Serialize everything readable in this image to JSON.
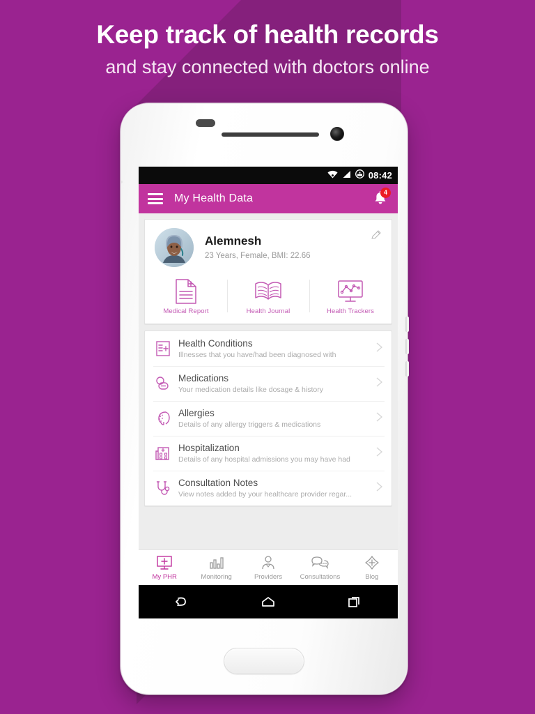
{
  "promo": {
    "headline_line1": "Keep track of health records",
    "headline_line2": "and stay connected with doctors online",
    "background_color": "#9A2390",
    "shadow_color": "#85207C"
  },
  "statusbar": {
    "time": "08:42",
    "icons": [
      "wifi-icon",
      "signal-icon",
      "battery-icon"
    ]
  },
  "appbar": {
    "menu_icon": "hamburger-menu-icon",
    "title": "My Health Data",
    "notification_icon": "bell-icon",
    "notification_count": "4",
    "color": "#C1349E"
  },
  "profile": {
    "avatar": "user-photo",
    "name": "Alemnesh",
    "details": "23 Years, Female, BMI: 22.66",
    "edit_icon": "pencil-edit-icon"
  },
  "quick_actions": [
    {
      "label": "Medical Report",
      "icon": "document-plus-icon"
    },
    {
      "label": "Health Journal",
      "icon": "open-book-icon"
    },
    {
      "label": "Health Trackers",
      "icon": "monitor-chart-icon"
    }
  ],
  "records": [
    {
      "title": "Health Conditions",
      "subtitle": "Illnesses that you have/had been diagnosed with",
      "icon": "clipboard-plus-icon"
    },
    {
      "title": "Medications",
      "subtitle": "Your medication details like dosage & history",
      "icon": "pills-icon"
    },
    {
      "title": "Allergies",
      "subtitle": "Details of any allergy triggers & medications",
      "icon": "face-allergy-icon"
    },
    {
      "title": "Hospitalization",
      "subtitle": "Details of any hospital admissions you may have had",
      "icon": "hospital-building-icon"
    },
    {
      "title": "Consultation Notes",
      "subtitle": "View notes added by your healthcare provider regar...",
      "icon": "stethoscope-icon"
    }
  ],
  "tabs": [
    {
      "label": "My PHR",
      "icon": "monitor-plus-icon",
      "active": true
    },
    {
      "label": "Monitoring",
      "icon": "bar-chart-icon",
      "active": false
    },
    {
      "label": "Providers",
      "icon": "doctor-person-icon",
      "active": false
    },
    {
      "label": "Consultations",
      "icon": "chat-bubbles-icon",
      "active": false
    },
    {
      "label": "Blog",
      "icon": "diamond-plus-icon",
      "active": false
    }
  ],
  "android_nav": {
    "back": "back-icon",
    "home": "home-icon",
    "recents": "recents-icon"
  },
  "colors": {
    "accent": "#C1349E",
    "icon_outline": "#C35AB4",
    "badge_red": "#EC1C24"
  }
}
